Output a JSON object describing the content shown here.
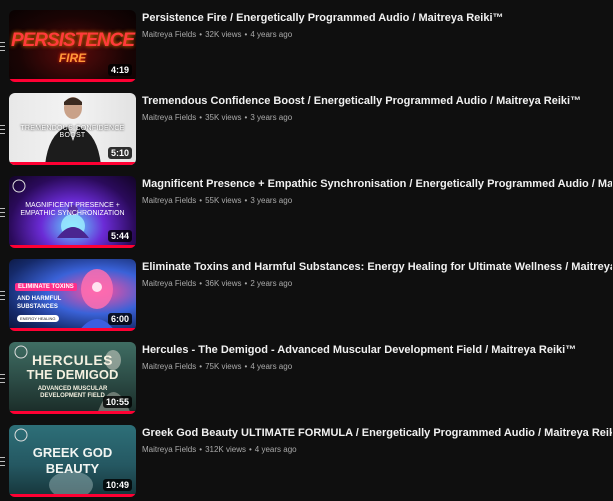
{
  "playlist": {
    "items": [
      {
        "title": "Persistence Fire / Energetically Programmed Audio / Maitreya Reiki™",
        "channel": "Maitreya Fields",
        "views": "32K views",
        "age": "4 years ago",
        "duration": "4:19",
        "thumb_text": [
          "PERSISTENCE",
          "FIRE"
        ],
        "thumb_icon": "fire-title-art"
      },
      {
        "title": "Tremendous Confidence Boost / Energetically Programmed Audio / Maitreya Reiki™",
        "channel": "Maitreya Fields",
        "views": "35K views",
        "age": "3 years ago",
        "duration": "5:10",
        "thumb_text": [
          "TREMENDOUS CONFIDENCE BOOST"
        ],
        "thumb_icon": "man-in-suit-image"
      },
      {
        "title": "Magnificent Presence + Empathic Synchronisation / Energetically Programmed Audio / Maitreya Reiki™",
        "channel": "Maitreya Fields",
        "views": "55K views",
        "age": "3 years ago",
        "duration": "5:44",
        "thumb_text": [
          "MAGNIFICENT PRESENCE +",
          "EMPATHIC SYNCHRONIZATION"
        ],
        "thumb_icon": "meditating-figure-image"
      },
      {
        "title": "Eliminate Toxins and Harmful Substances: Energy Healing for Ultimate Wellness / Maitreya Reiki™",
        "channel": "Maitreya Fields",
        "views": "36K views",
        "age": "2 years ago",
        "duration": "6:00",
        "thumb_text": [
          "ELIMINATE TOXINS",
          "AND HARMFUL SUBSTANCES",
          "ENERGY HEALING"
        ],
        "thumb_icon": "glowing-head-image"
      },
      {
        "title": "Hercules - The Demigod - Advanced Muscular Development Field / Maitreya Reiki™",
        "channel": "Maitreya Fields",
        "views": "75K views",
        "age": "4 years ago",
        "duration": "10:55",
        "thumb_text": [
          "HERCULES",
          "THE DEMIGOD",
          "ADVANCED MUSCULAR",
          "DEVELOPMENT FIELD"
        ],
        "thumb_icon": "statue-image"
      },
      {
        "title": "Greek God Beauty ULTIMATE FORMULA / Energetically Programmed Audio / Maitreya Reiki™",
        "channel": "Maitreya Fields",
        "views": "312K views",
        "age": "4 years ago",
        "duration": "10:49",
        "thumb_text": [
          "GREEK GOD",
          "BEAUTY"
        ],
        "thumb_icon": "statue-image"
      }
    ],
    "separator": "•",
    "colors": {
      "background": "#0f0f0f",
      "progress": "#ff0033",
      "meta": "#aaaaaa",
      "title": "#f1f1f1"
    }
  }
}
